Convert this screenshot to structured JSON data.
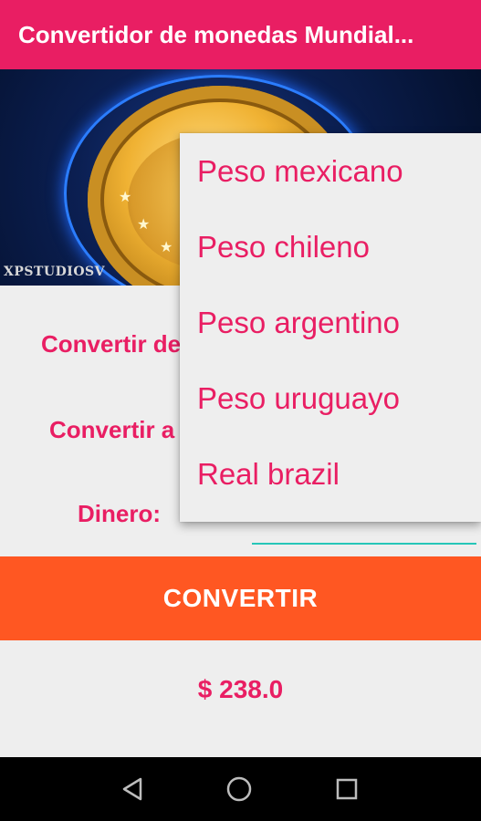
{
  "app": {
    "title": "Convertidor de monedas Mundial..."
  },
  "banner": {
    "watermark": "XPSTUDIOSV"
  },
  "form": {
    "from_label": "Convertir de",
    "to_label": "Convertir a",
    "money_label": "Dinero:",
    "money_value": ""
  },
  "dropdown": {
    "options": [
      "Peso mexicano",
      "Peso chileno",
      "Peso argentino",
      "Peso uruguayo",
      "Real brazil"
    ]
  },
  "actions": {
    "convert_label": "CONVERTIR"
  },
  "result": {
    "text": "$ 238.0"
  },
  "nav": {
    "icons": [
      "back-icon",
      "home-icon",
      "recents-icon"
    ]
  },
  "colors": {
    "primary": "#e91e63",
    "accent": "#ff5722",
    "input_underline": "#26c6b8",
    "background": "#eeeeee"
  }
}
